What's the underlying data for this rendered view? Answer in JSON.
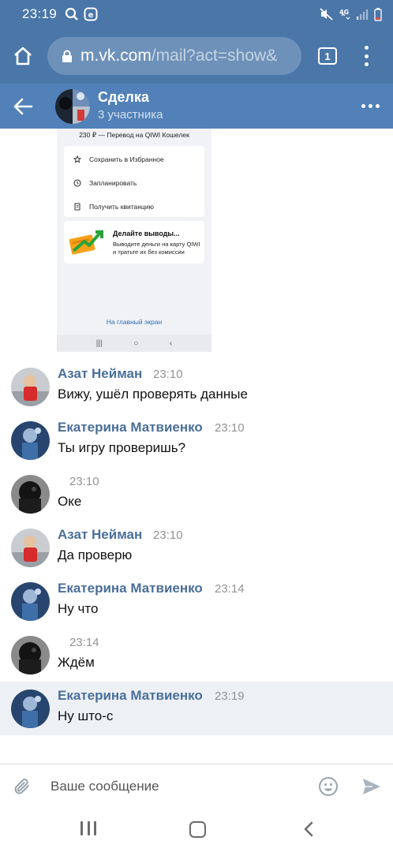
{
  "status_bar": {
    "time": "23:19"
  },
  "browser": {
    "url_host": "m.vk.com",
    "url_path": "/mail?act=show&",
    "tab_count": "1"
  },
  "chat": {
    "title": "Сделка",
    "subtitle": "3 участника"
  },
  "attachment": {
    "transfer_text": "230 ₽ — Перевод на QIWI Кошелек",
    "actions": [
      {
        "label": "Сохранить в Избранное",
        "icon": "star-icon"
      },
      {
        "label": "Запланировать",
        "icon": "clock-icon"
      },
      {
        "label": "Получить квитанцию",
        "icon": "receipt-icon"
      }
    ],
    "promo_title": "Делайте выводы...",
    "promo_text": "Выводите деньги на карту QIWI и тратьте их без комиссии",
    "home_link": "На главный экран"
  },
  "messages": [
    {
      "author": "Азат Нейман",
      "time": "23:10",
      "text": "Вижу, ушёл проверять данные",
      "avatar": "azat"
    },
    {
      "author": "Екатерина Матвиенко",
      "time": "23:10",
      "text": "Ты игру проверишь?",
      "avatar": "ekaterina"
    },
    {
      "author": "",
      "time": "23:10",
      "text": "Оке",
      "avatar": "dark"
    },
    {
      "author": "Азат Нейман",
      "time": "23:10",
      "text": "Да проверю",
      "avatar": "azat"
    },
    {
      "author": "Екатерина Матвиенко",
      "time": "23:14",
      "text": "Ну что",
      "avatar": "ekaterina"
    },
    {
      "author": "",
      "time": "23:14",
      "text": "Ждём",
      "avatar": "dark"
    },
    {
      "author": "Екатерина Матвиенко",
      "time": "23:19",
      "text": "Ну што-с",
      "avatar": "ekaterina"
    }
  ],
  "composer": {
    "placeholder": "Ваше сообщение"
  },
  "colors": {
    "header": "#4a76a8",
    "chat_header": "#5181b8",
    "author": "#4a6f9a",
    "highlight": "#edf0f5"
  }
}
